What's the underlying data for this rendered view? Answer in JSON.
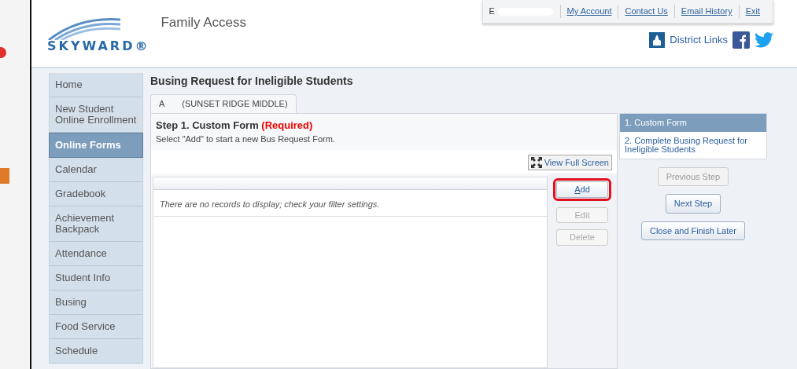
{
  "header": {
    "logo_text": "SKYWARD®",
    "product": "Family Access",
    "user_name": "E",
    "top_links": [
      "My Account",
      "Contact Us",
      "Email History",
      "Exit"
    ],
    "district_links": "District Links"
  },
  "sidebar": {
    "items": [
      {
        "label": "Home",
        "selected": false
      },
      {
        "label": "New Student Online Enrollment",
        "selected": false
      },
      {
        "label": "Online Forms",
        "selected": true
      },
      {
        "label": "Calendar",
        "selected": false
      },
      {
        "label": "Gradebook",
        "selected": false
      },
      {
        "label": "Achievement Backpack",
        "selected": false
      },
      {
        "label": "Attendance",
        "selected": false
      },
      {
        "label": "Student Info",
        "selected": false
      },
      {
        "label": "Busing",
        "selected": false
      },
      {
        "label": "Food Service",
        "selected": false
      },
      {
        "label": "Schedule",
        "selected": false
      }
    ]
  },
  "page_title": "Busing Request for Ineligible Students",
  "student_tab": {
    "initial": "A",
    "school": "(SUNSET RIDGE MIDDLE)"
  },
  "step": {
    "title": "Step 1. Custom Form",
    "required": "(Required)",
    "instruction": "Select \"Add\" to start a new Bus Request Form."
  },
  "view_full_screen": "View Full Screen",
  "grid": {
    "empty_message": "There are no records to display; check your filter settings."
  },
  "grid_buttons": [
    {
      "label": "Add",
      "disabled": false,
      "highlighted": true
    },
    {
      "label": "Edit",
      "disabled": true,
      "highlighted": false
    },
    {
      "label": "Delete",
      "disabled": true,
      "highlighted": false
    }
  ],
  "steps": [
    {
      "label": "1. Custom Form",
      "selected": true
    },
    {
      "label": "2. Complete Busing Request for Ineligible Students",
      "selected": false
    }
  ],
  "nav_buttons": [
    {
      "label": "Previous Step",
      "disabled": true
    },
    {
      "label": "Next Step",
      "disabled": false
    },
    {
      "label": "Close and Finish Later",
      "disabled": false
    }
  ]
}
